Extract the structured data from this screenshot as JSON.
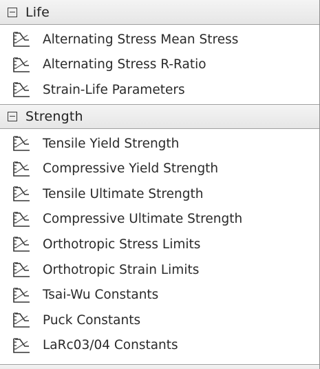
{
  "sections": [
    {
      "title": "Life",
      "items": [
        {
          "label": "Alternating Stress Mean Stress"
        },
        {
          "label": "Alternating Stress R-Ratio"
        },
        {
          "label": "Strain-Life Parameters"
        }
      ]
    },
    {
      "title": "Strength",
      "items": [
        {
          "label": "Tensile Yield Strength"
        },
        {
          "label": "Compressive Yield Strength"
        },
        {
          "label": "Tensile Ultimate Strength"
        },
        {
          "label": "Compressive Ultimate Strength"
        },
        {
          "label": "Orthotropic Stress Limits"
        },
        {
          "label": "Orthotropic Strain Limits"
        },
        {
          "label": "Tsai-Wu Constants"
        },
        {
          "label": "Puck Constants"
        },
        {
          "label": "LaRc03/04 Constants"
        }
      ]
    }
  ],
  "icons": {
    "property": "property-chart-icon",
    "expanded": "collapse-minus-icon"
  },
  "colors": {
    "header_bg": "#ececec",
    "border": "#a0a0a0",
    "text": "#222222"
  }
}
